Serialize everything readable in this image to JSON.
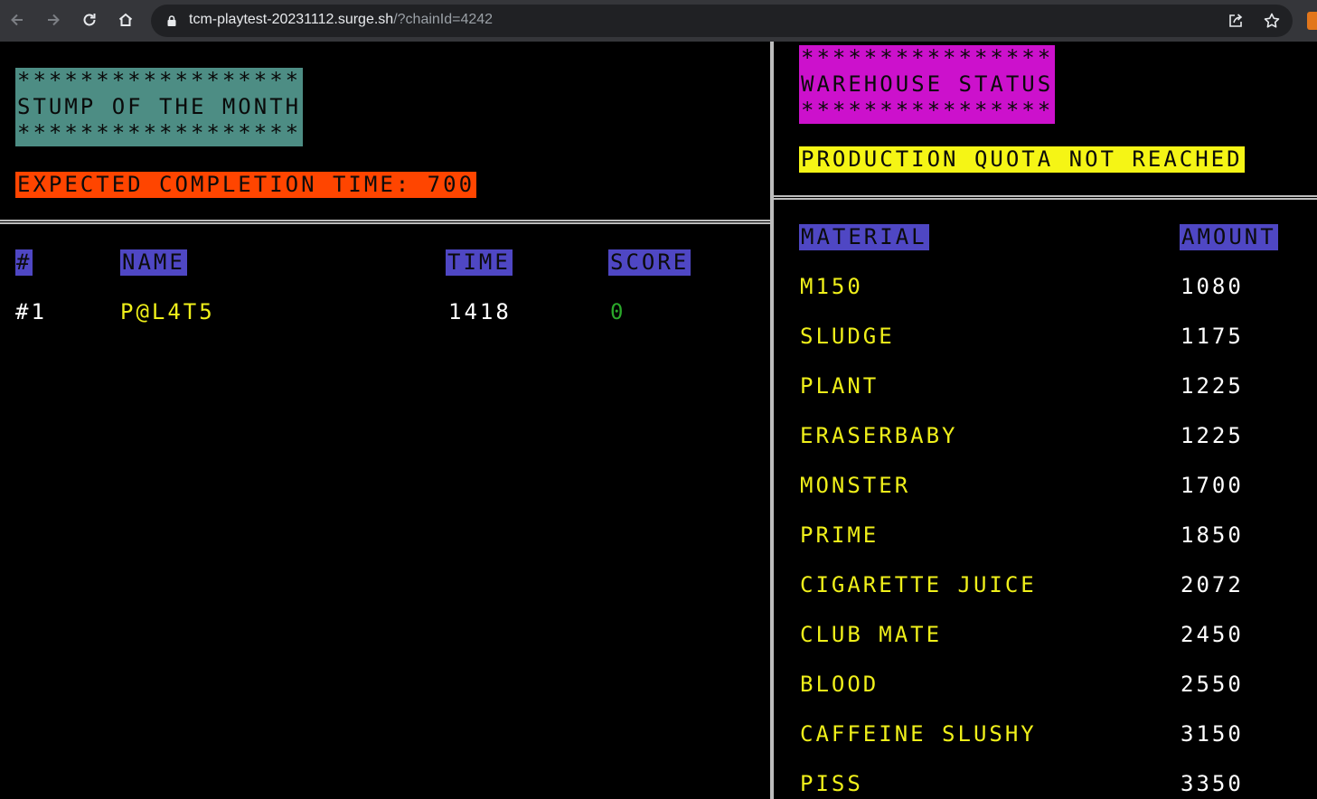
{
  "browser": {
    "url_host": "tcm-playtest-20231112.surge.sh",
    "url_query": "/?chainId=4242"
  },
  "stump": {
    "stars": "******************",
    "title": "STUMP OF THE MONTH",
    "expected": "EXPECTED COMPLETION TIME: 700"
  },
  "leaderboard": {
    "headers": {
      "rank": "#",
      "name": "NAME",
      "time": "TIME",
      "score": "SCORE"
    },
    "rows": [
      {
        "rank": "#1",
        "name": "P@L4T5",
        "time": "1418",
        "score": "0"
      }
    ]
  },
  "warehouse": {
    "stars": "****************",
    "title": "WAREHOUSE STATUS",
    "quota": "PRODUCTION QUOTA NOT REACHED",
    "headers": {
      "material": "MATERIAL",
      "amount": "AMOUNT"
    },
    "rows": [
      {
        "material": "M150",
        "amount": "1080"
      },
      {
        "material": "SLUDGE",
        "amount": "1175"
      },
      {
        "material": "PLANT",
        "amount": "1225"
      },
      {
        "material": "ERASERBABY",
        "amount": "1225"
      },
      {
        "material": "MONSTER",
        "amount": "1700"
      },
      {
        "material": "PRIME",
        "amount": "1850"
      },
      {
        "material": "CIGARETTE JUICE",
        "amount": "2072"
      },
      {
        "material": "CLUB MATE",
        "amount": "2450"
      },
      {
        "material": "BLOOD",
        "amount": "2550"
      },
      {
        "material": "CAFFEINE SLUSHY",
        "amount": "3150"
      },
      {
        "material": "PISS",
        "amount": "3350"
      }
    ]
  },
  "colors": {
    "stump_bg": "#4d8d84",
    "expected_bg": "#ff4500",
    "warehouse_bg": "#cc11cc",
    "quota_bg": "#f5f515",
    "header_bg": "#4f47c4",
    "name_color": "#f0f01a",
    "score_color": "#2aa82a"
  }
}
